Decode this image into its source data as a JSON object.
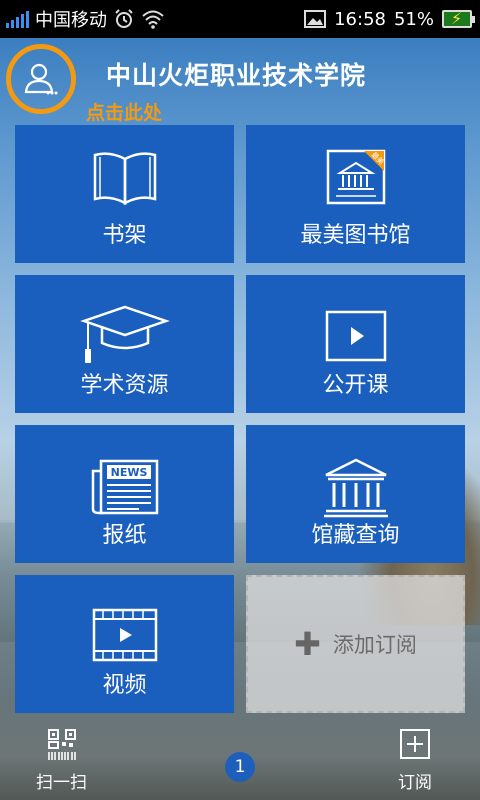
{
  "status_bar": {
    "carrier": "中国移动",
    "time": "16:58",
    "battery": "51%",
    "signal_icon": "signal-icon",
    "alarm_icon": "alarm-icon",
    "wifi_icon": "wifi-icon",
    "gallery_icon": "image-icon",
    "battery_icon": "battery-charging-icon"
  },
  "header": {
    "title": "中山火炬职业技术学院",
    "hint": "点击此处",
    "avatar_icon": "user-icon",
    "accent_color": "#f39a11"
  },
  "tiles": [
    {
      "label": "书架",
      "icon": "book-icon"
    },
    {
      "label": "最美图书馆",
      "icon": "library-card-icon",
      "badge": "最美"
    },
    {
      "label": "学术资源",
      "icon": "graduation-cap-icon"
    },
    {
      "label": "公开课",
      "icon": "play-icon"
    },
    {
      "label": "报纸",
      "icon": "newspaper-icon",
      "icon_text": "NEWS"
    },
    {
      "label": "馆藏查询",
      "icon": "library-building-icon"
    },
    {
      "label": "视频",
      "icon": "video-icon"
    }
  ],
  "add_tile": {
    "label": "添加订阅",
    "icon": "plus-icon"
  },
  "bottom_bar": {
    "scan_label": "扫一扫",
    "scan_icon": "qr-code-icon",
    "page_indicator": "1",
    "subscribe_label": "订阅",
    "subscribe_icon": "add-box-icon"
  },
  "colors": {
    "tile_blue": "#1a5fbd",
    "status_bar": "#000000"
  }
}
